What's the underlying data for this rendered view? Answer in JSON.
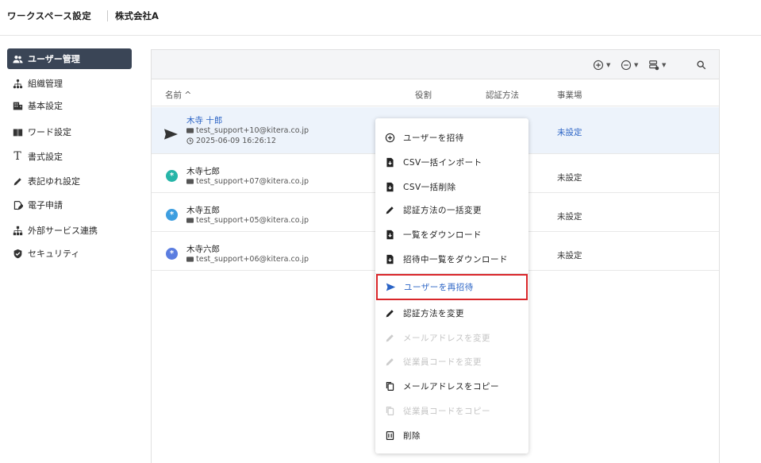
{
  "header": {
    "title": "ワークスペース設定",
    "org": "株式会社A"
  },
  "sidebar": {
    "items": [
      {
        "label": "ユーザー管理",
        "icon": "users-icon",
        "active": true
      },
      {
        "label": "組織管理",
        "icon": "org-tree-icon"
      },
      {
        "label": "基本設定",
        "icon": "building-icon"
      },
      {
        "label": "ワード設定",
        "icon": "book-icon"
      },
      {
        "label": "書式設定",
        "icon": "text-format-icon"
      },
      {
        "label": "表記ゆれ設定",
        "icon": "pencil-icon"
      },
      {
        "label": "電子申請",
        "icon": "doc-sign-icon"
      },
      {
        "label": "外部サービス連携",
        "icon": "network-icon"
      },
      {
        "label": "セキュリティ",
        "icon": "shield-icon"
      }
    ]
  },
  "table": {
    "columns": {
      "name": "名前 ^",
      "role": "役割",
      "auth": "認証方法",
      "site": "事業場"
    },
    "rows": [
      {
        "name": "木寺 十郎",
        "email": "test_support+10@kitera.co.jp",
        "timestamp": "2025-06-09 16:26:12",
        "site": "未設定",
        "status": "invited"
      },
      {
        "name": "木寺七郎",
        "email": "test_support+07@kitera.co.jp",
        "site": "未設定",
        "avatar_color": "#26b5a8"
      },
      {
        "name": "木寺五郎",
        "email": "test_support+05@kitera.co.jp",
        "site": "未設定",
        "avatar_color": "#3d9ee0"
      },
      {
        "name": "木寺六郎",
        "email": "test_support+06@kitera.co.jp",
        "site": "未設定",
        "avatar_color": "#5b7de0"
      }
    ]
  },
  "menu": {
    "items": [
      {
        "label": "ユーザーを招待",
        "icon": "plus-circle-icon"
      },
      {
        "label": "CSV一括インポート",
        "icon": "file-import-icon"
      },
      {
        "label": "CSV一括削除",
        "icon": "file-delete-icon"
      },
      {
        "label": "認証方法の一括変更",
        "icon": "pencil-icon"
      },
      {
        "label": "一覧をダウンロード",
        "icon": "file-download-icon"
      },
      {
        "label": "招待中一覧をダウンロード",
        "icon": "file-download-icon"
      },
      {
        "label": "ユーザーを再招待",
        "icon": "send-icon",
        "highlight": true
      },
      {
        "label": "認証方法を変更",
        "icon": "pencil-icon"
      },
      {
        "label": "メールアドレスを変更",
        "icon": "pencil-icon",
        "disabled": true
      },
      {
        "label": "従業員コードを変更",
        "icon": "pencil-icon",
        "disabled": true
      },
      {
        "label": "メールアドレスをコピー",
        "icon": "copy-icon"
      },
      {
        "label": "従業員コードをコピー",
        "icon": "copy-icon",
        "disabled": true
      },
      {
        "label": "削除",
        "icon": "trash-icon"
      }
    ]
  },
  "colors": {
    "accent": "#2a63c5",
    "sidebar_active": "#3a4556",
    "highlight_border": "#d9262a"
  }
}
